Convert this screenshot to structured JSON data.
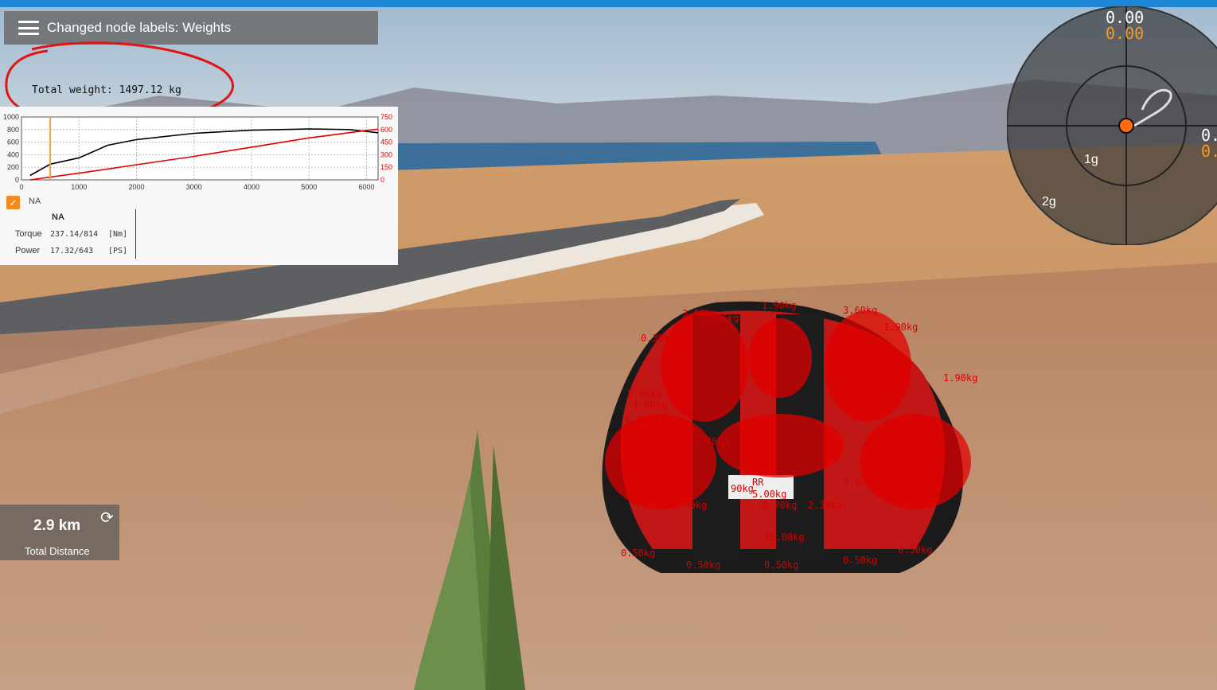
{
  "message": {
    "text": "Changed node labels: Weights"
  },
  "total_weight": "Total weight: 1497.12 kg",
  "chart": {
    "left_ticks": [
      "1000",
      "800",
      "600",
      "400",
      "200",
      "0"
    ],
    "right_ticks": [
      "750",
      "600",
      "450",
      "300",
      "150",
      "0"
    ],
    "x_ticks": [
      "0",
      "1000",
      "2000",
      "3000",
      "4000",
      "5000",
      "6000"
    ]
  },
  "chart_data": {
    "type": "line",
    "x_ticks": [
      0,
      1000,
      2000,
      3000,
      4000,
      5000,
      6000
    ],
    "xlim": [
      0,
      6200
    ],
    "ylim_left": [
      0,
      1000
    ],
    "ylim_right": [
      0,
      750
    ],
    "series": [
      {
        "color": "#000000",
        "axis": "left",
        "x": [
          150,
          500,
          1000,
          1500,
          2000,
          3000,
          4000,
          5000,
          5700,
          6200
        ],
        "y": [
          70,
          250,
          350,
          550,
          640,
          740,
          790,
          810,
          800,
          750
        ]
      },
      {
        "color": "#e00000",
        "axis": "right",
        "x": [
          150,
          1000,
          2000,
          3000,
          4000,
          5000,
          6000,
          6200
        ],
        "y": [
          0,
          80,
          180,
          280,
          390,
          500,
          590,
          605
        ]
      }
    ],
    "rpm_marker": {
      "x": 500,
      "color": "#f3a13a"
    }
  },
  "engine": {
    "checkbox_label": "NA",
    "header": "NA",
    "rows": [
      {
        "name": "Torque",
        "value": "237.14/814",
        "unit": "[Nm]"
      },
      {
        "name": "Power",
        "value": "17.32/643",
        "unit": "[PS]"
      }
    ]
  },
  "distance": {
    "value": "2.9 km",
    "label": "Total Distance",
    "reset_icon": "refresh-icon"
  },
  "gforce": {
    "x_white": "0.00",
    "x_orange": "0.00",
    "right_white": "0.",
    "right_orange": "0.",
    "ring1": "1g",
    "ring2": "2g"
  },
  "node_labels": [
    "3.60kg",
    "1.90kg",
    "3.60kg",
    "0.30kg",
    "1.90kg",
    "1.80kg",
    "2.90kg",
    "1.40kg",
    "0.70kg",
    "5.00kg",
    "0.70kg",
    "0.50kg",
    "0.50kg",
    "0.50kg",
    "0.50kg",
    "0.50kg",
    "15.00kg",
    "0.90kg",
    "RR",
    "90kg",
    "2.30kg",
    "1.90kg",
    "2.50kg",
    "5.00kg"
  ],
  "colors": {
    "accent": "#1e88d6",
    "check": "#f28c1f",
    "node_label": "#d40000"
  }
}
